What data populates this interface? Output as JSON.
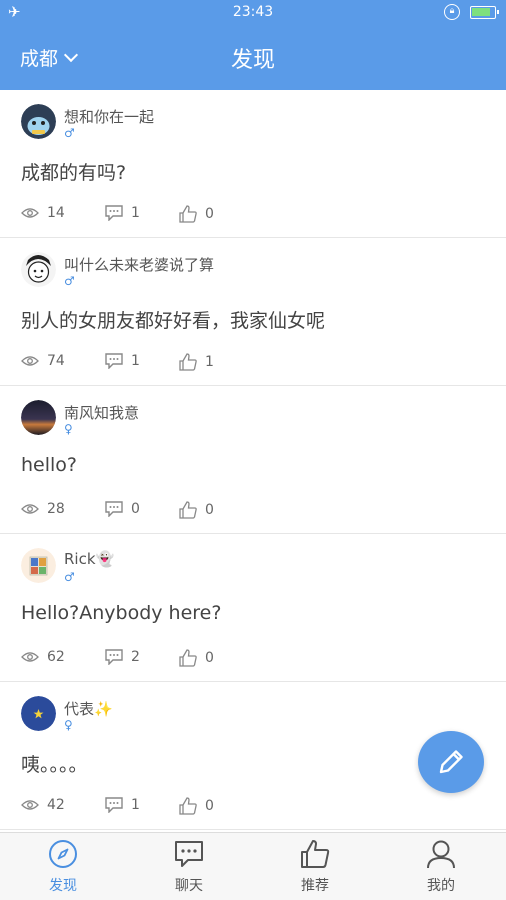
{
  "status_bar": {
    "time": "23:43"
  },
  "header": {
    "city": "成都",
    "title": "发现"
  },
  "posts": [
    {
      "username": "想和你在一起",
      "gender": "♂",
      "content": "成都的有吗?",
      "views": "14",
      "comments": "1",
      "likes": "0"
    },
    {
      "username": "叫什么未来老婆说了算",
      "gender": "♂",
      "content": "别人的女朋友都好好看，我家仙女呢",
      "views": "74",
      "comments": "1",
      "likes": "1"
    },
    {
      "username": "南风知我意",
      "gender": "♀",
      "content": "hello?",
      "views": "28",
      "comments": "0",
      "likes": "0"
    },
    {
      "username": "Rick👻",
      "gender": "♂",
      "content": "Hello?Anybody here?",
      "views": "62",
      "comments": "2",
      "likes": "0"
    },
    {
      "username": "代表✨",
      "gender": "♀",
      "content": "咦。。。。",
      "views": "42",
      "comments": "1",
      "likes": "0"
    }
  ],
  "tabs": [
    {
      "label": "发现",
      "icon": "compass-icon",
      "active": true
    },
    {
      "label": "聊天",
      "icon": "chat-icon",
      "active": false
    },
    {
      "label": "推荐",
      "icon": "thumbs-up-icon",
      "active": false
    },
    {
      "label": "我的",
      "icon": "user-icon",
      "active": false
    }
  ],
  "colors": {
    "primary": "#5a9be8",
    "gender_icon": "#4a8fe0",
    "text": "#444444",
    "meta": "#666666"
  }
}
